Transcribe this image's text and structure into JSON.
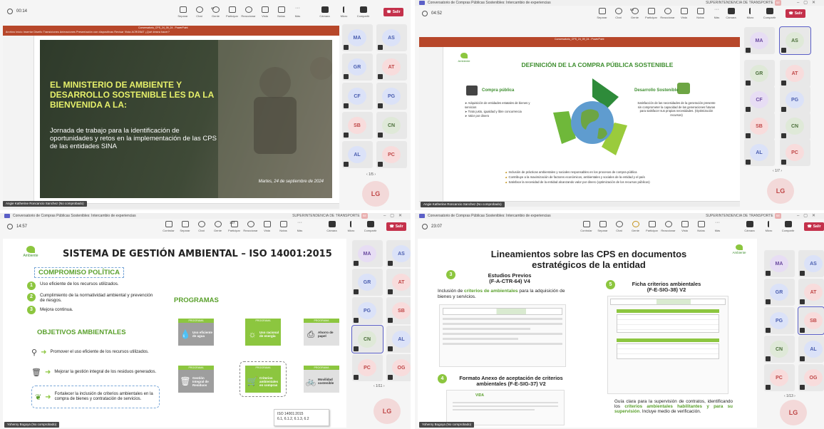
{
  "toolbar_labels": {
    "controlar": "Controlar",
    "separar": "Separar",
    "chat": "Chat",
    "gente": "Gente",
    "participar": "Participar",
    "reaccionar": "Reaccionar",
    "vista": "Vista",
    "notas": "Notas",
    "mas": "Más",
    "camara": "Cámara",
    "micro": "Micro",
    "compartir": "Compartir",
    "salir": "Salir",
    "more_dots": "···"
  },
  "colors": {
    "teams_accent": "#5b5fc7",
    "leave_red": "#c4314b",
    "ppt_red": "#b7472a",
    "green_dark": "#3e8e2f",
    "green_light": "#8cc63f"
  },
  "q1": {
    "timer": "00:14",
    "people_count": "47",
    "ppt_filename": "Conversatorio_CPS_24_09_24 - PowerPoint",
    "ppt_tabs": "Archivo  Inicio  Insertar  Diseño  Transiciones  Animaciones  Presentación con diapositivas  Revisar  Vista  ACROBAT  ¿Qué desea hacer?",
    "slide_title": "EL MINISTERIO DE AMBIENTE Y DESARROLLO SOSTENIBLE LES DA LA BIENVENIDA A LA:",
    "slide_subtitle": "Jornada de trabajo para la identificación de oportunidades y retos en la implementación de las CPS de las entidades SINA",
    "slide_date": "Martes, 24 de septiembre de 2024",
    "presenter": "Angie Katherine Roncancio Sanchez (No comprobado)",
    "tiles": [
      "MA",
      "AS",
      "GR",
      "AT",
      "CF",
      "PG",
      "SB",
      "CN",
      "AL",
      "PC"
    ],
    "pager": "1/5",
    "self": "LG"
  },
  "q2": {
    "window_title": "Conversatorio de Compras Públicas Sostenibles: Intercambio de experiencias",
    "org": "SUPERINTENDENCIA DE TRANSPORTE",
    "org_tag": "SE",
    "timer": "04:52",
    "people_count": "63",
    "ppt_filename": "Conversatorio_CPS_24_09_24 - PowerPoint",
    "logo_text": "Ambiente",
    "slide_title": "DEFINICIÓN DE LA COMPRA PÚBLICA SOSTENIBLE",
    "left_heading": "Compra pública",
    "left_bullets": [
      "Adquisición de entidades estatales de bienes y servicios",
      "Trato justo, igualdad y libre concurrencia",
      "Valor por dinero"
    ],
    "right_heading": "Desarrollo Sostenible",
    "right_text": "Satisfacción de las necesidades de la generación presente sin comprometer la capacidad de las generaciones futuras para satisfacer sus propias necesidades. (Optimización recursos)",
    "bottom_bullets": [
      "Inclusión de prácticas ambientales y sociales responsables en los procesos de compra pública",
      "Contribuye a la maximización de factores económicos, ambientales y sociales de la entidad y el país",
      "Satisface la necesidad de la entidad alcanzando valor por dinero (optimización de los recursos públicos)"
    ],
    "presenter": "Angie Katherine Roncancio Sanchez (No comprobado)",
    "tiles": [
      "MA",
      "AS",
      "GR",
      "AT",
      "CF",
      "PG",
      "SB",
      "CN",
      "AL",
      "PC"
    ],
    "pager": "1/7",
    "self": "LG"
  },
  "q3": {
    "window_title": "Conversatorio de Compras Públicas Sostenibles: Intercambio de experiencias",
    "org": "SUPERINTENDENCIA DE TRANSPORTE",
    "org_tag": "SE",
    "timer": "14:57",
    "people_count": "107",
    "logo_text": "Ambiente",
    "slide_title": "SISTEMA DE GESTIÓN AMBIENTAL – ISO 14001:2015",
    "compromiso_heading": "COMPROMISO POLÍTICA",
    "compromiso_items": [
      {
        "num": "1",
        "text": "Uso eficiente de los recursos utilizados."
      },
      {
        "num": "2",
        "text": "Cumplimiento de la normatividad ambiental y prevención de riesgos."
      },
      {
        "num": "3",
        "text": "Mejora continua."
      }
    ],
    "objetivos_heading": "OBJETIVOS AMBIENTALES",
    "objetivos_items": [
      "Promover el uso eficiente de los recursos utilizados.",
      "Mejorar la gestión integral de los residuos generados.",
      "Fortalecer la inclusión de criterios ambientales en la compra de bienes y contratación de servicios."
    ],
    "programas_heading": "PROGRAMAS",
    "programa_tag": "PROGRAMA",
    "programas": [
      "Uso eficiente de agua",
      "Uso racional de energía",
      "Ahorro de papel",
      "Gestión Integral de Residuos",
      "Criterios ambientales en compras",
      "Movilidad sostenible"
    ],
    "iso_note_1": "ISO 14001:2015",
    "iso_note_2": "6.1, 6.1.2, 6.1.3, 6.2",
    "presenter": "Yohenry Bogoya (No comprobado)",
    "tiles": [
      "MA",
      "AS",
      "GR",
      "AT",
      "PG",
      "SB",
      "CN",
      "AL",
      "PC",
      "OG"
    ],
    "pager": "1/11",
    "self": "LG"
  },
  "q4": {
    "window_title": "Conversatorio de Compras Públicas Sostenibles: Intercambio de experiencias",
    "org": "SUPERINTENDENCIA DE TRANSPORTE",
    "org_tag": "SE",
    "timer": "23:07",
    "people_count": "",
    "logo_text": "Ambiente",
    "slide_title_1": "Lineamientos sobre las CPS en documentos",
    "slide_title_2": "estratégicos de la entidad",
    "s3_num": "3",
    "s3_title_1": "Estudios Previos",
    "s3_title_2": "(F-A-CTR-64) V4",
    "s3_desc_a": "Inclusión de ",
    "s3_desc_b": "criterios de ambientales",
    "s3_desc_c": " para la adquisición de bienes y servicios.",
    "s4_num": "4",
    "s4_title_1": "Formato Anexo de aceptación de criterios",
    "s4_title_2": "ambientales (F-E-SIG-37) V2",
    "vida_logo": "VIDA",
    "s5_num": "5",
    "s5_title_1": "Ficha criterios ambientales",
    "s5_title_2": "(F-E-SIG-38) V2",
    "s5_desc_a": "Guía clara para la supervisión de contratos, identificando los ",
    "s5_desc_b": "criterios ambientales habilitantes y para su supervisión",
    "s5_desc_c": ". Incluye medio de verificación.",
    "presenter": "Yohenry Bogoya (No comprobado)",
    "tiles": [
      "MA",
      "AS",
      "GR",
      "AT",
      "PG",
      "SB",
      "CN",
      "AL",
      "PC",
      "OG"
    ],
    "pager": "1/13",
    "self": "LG"
  }
}
